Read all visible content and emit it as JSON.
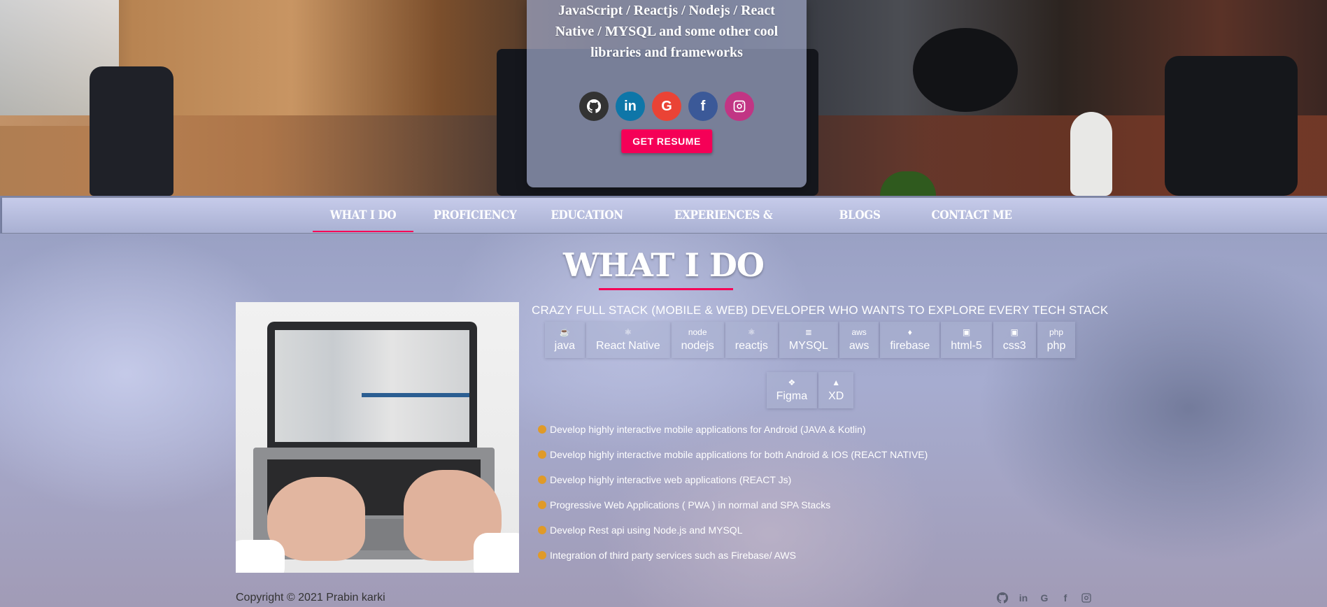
{
  "intro": {
    "text": "JavaScript / Reactjs / Nodejs / React Native / MYSQL and some other cool libraries and frameworks",
    "resume_label": "GET RESUME"
  },
  "social": [
    {
      "icon": "github-icon",
      "color": "#333333"
    },
    {
      "icon": "linkedin-icon",
      "color": "#0e76a8",
      "label": "in"
    },
    {
      "icon": "google-icon",
      "color": "#ea4335",
      "label": "G"
    },
    {
      "icon": "facebook-icon",
      "color": "#3b5998",
      "label": "f"
    },
    {
      "icon": "instagram-icon",
      "color": "#c13584"
    }
  ],
  "nav": {
    "tabs": [
      "WHAT I DO",
      "PROFICIENCY",
      "EDUCATION",
      "EXPERIENCES & PROJECTS",
      "BLOGS",
      "CONTACT ME"
    ],
    "active": "WHAT I DO",
    "accent": "#f50057"
  },
  "section": {
    "title": "WHAT I DO",
    "subtitle": "CRAZY FULL STACK (MOBILE & WEB) DEVELOPER WHO WANTS TO EXPLORE EVERY TECH STACK"
  },
  "skills": [
    {
      "name": "java",
      "icon": "java-icon"
    },
    {
      "name": "React Native",
      "icon": "react-icon"
    },
    {
      "name": "nodejs",
      "icon": "nodejs-icon",
      "glyph": "node"
    },
    {
      "name": "reactjs",
      "icon": "react-icon"
    },
    {
      "name": "MYSQL",
      "icon": "database-icon"
    },
    {
      "name": "aws",
      "icon": "aws-icon",
      "glyph": "aws"
    },
    {
      "name": "firebase",
      "icon": "firebase-icon"
    },
    {
      "name": "html-5",
      "icon": "html5-icon"
    },
    {
      "name": "css3",
      "icon": "css3-icon"
    },
    {
      "name": "php",
      "icon": "php-icon",
      "glyph": "php"
    },
    {
      "name": "Figma",
      "icon": "figma-icon"
    },
    {
      "name": "XD",
      "icon": "adobe-icon"
    }
  ],
  "bullets": [
    "Develop highly interactive mobile applications for Android (JAVA & Kotlin)",
    "Develop highly interactive mobile applications for both Android & IOS (REACT NATIVE)",
    "Develop highly interactive web applications (REACT Js)",
    "Progressive Web Applications ( PWA ) in normal and SPA Stacks",
    "Develop Rest api using Node.js and MYSQL",
    "Integration of third party services such as Firebase/ AWS"
  ],
  "footer": {
    "copyright": "Copyright © 2021 Prabin karki",
    "icons": [
      "github-icon",
      "linkedin-icon",
      "google-icon",
      "facebook-icon",
      "instagram-icon"
    ]
  }
}
